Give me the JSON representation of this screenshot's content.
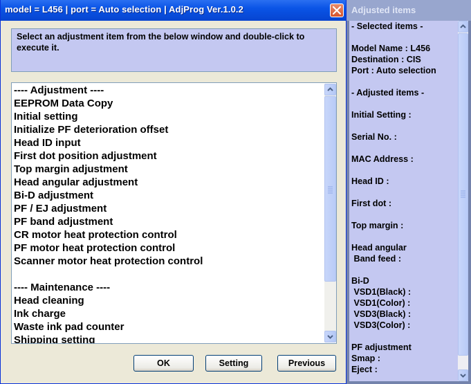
{
  "window": {
    "title": "model = L456  |  port = Auto selection  |  AdjProg Ver.1.0.2",
    "instruction": "Select an adjustment item from the below window and double-click to execute it."
  },
  "list": {
    "items": [
      "---- Adjustment ----",
      "EEPROM Data Copy",
      "Initial setting",
      "Initialize PF deterioration offset",
      "Head ID input",
      "First dot position adjustment",
      "Top margin adjustment",
      "Head angular adjustment",
      "Bi-D adjustment",
      "PF / EJ adjustment",
      "PF band adjustment",
      "CR motor heat protection control",
      "PF motor heat protection control",
      "Scanner motor heat protection control",
      "",
      "---- Maintenance ----",
      "Head cleaning",
      "Ink charge",
      "Waste ink pad counter",
      "Shipping setting"
    ]
  },
  "buttons": {
    "ok": "OK",
    "setting": "Setting",
    "previous": "Previous"
  },
  "side_panel": {
    "title": "Adjusted items",
    "lines": [
      "- Selected items -",
      "",
      "Model Name : L456",
      "Destination : CIS",
      "Port : Auto selection",
      "",
      "- Adjusted items -",
      "",
      "Initial Setting :",
      "",
      "Serial No. :",
      "",
      "MAC Address :",
      "",
      "Head ID :",
      "",
      "First dot :",
      "",
      "Top margin :",
      "",
      "Head angular",
      " Band feed :",
      "",
      "Bi-D",
      " VSD1(Black) :",
      " VSD1(Color) :",
      " VSD3(Black) :",
      " VSD3(Color) :",
      "",
      "PF adjustment",
      "Smap :",
      "Eject :"
    ]
  },
  "colors": {
    "titlebar": "#0a54e6",
    "panel_bg": "#c4c8f1",
    "close": "#d6542b"
  }
}
